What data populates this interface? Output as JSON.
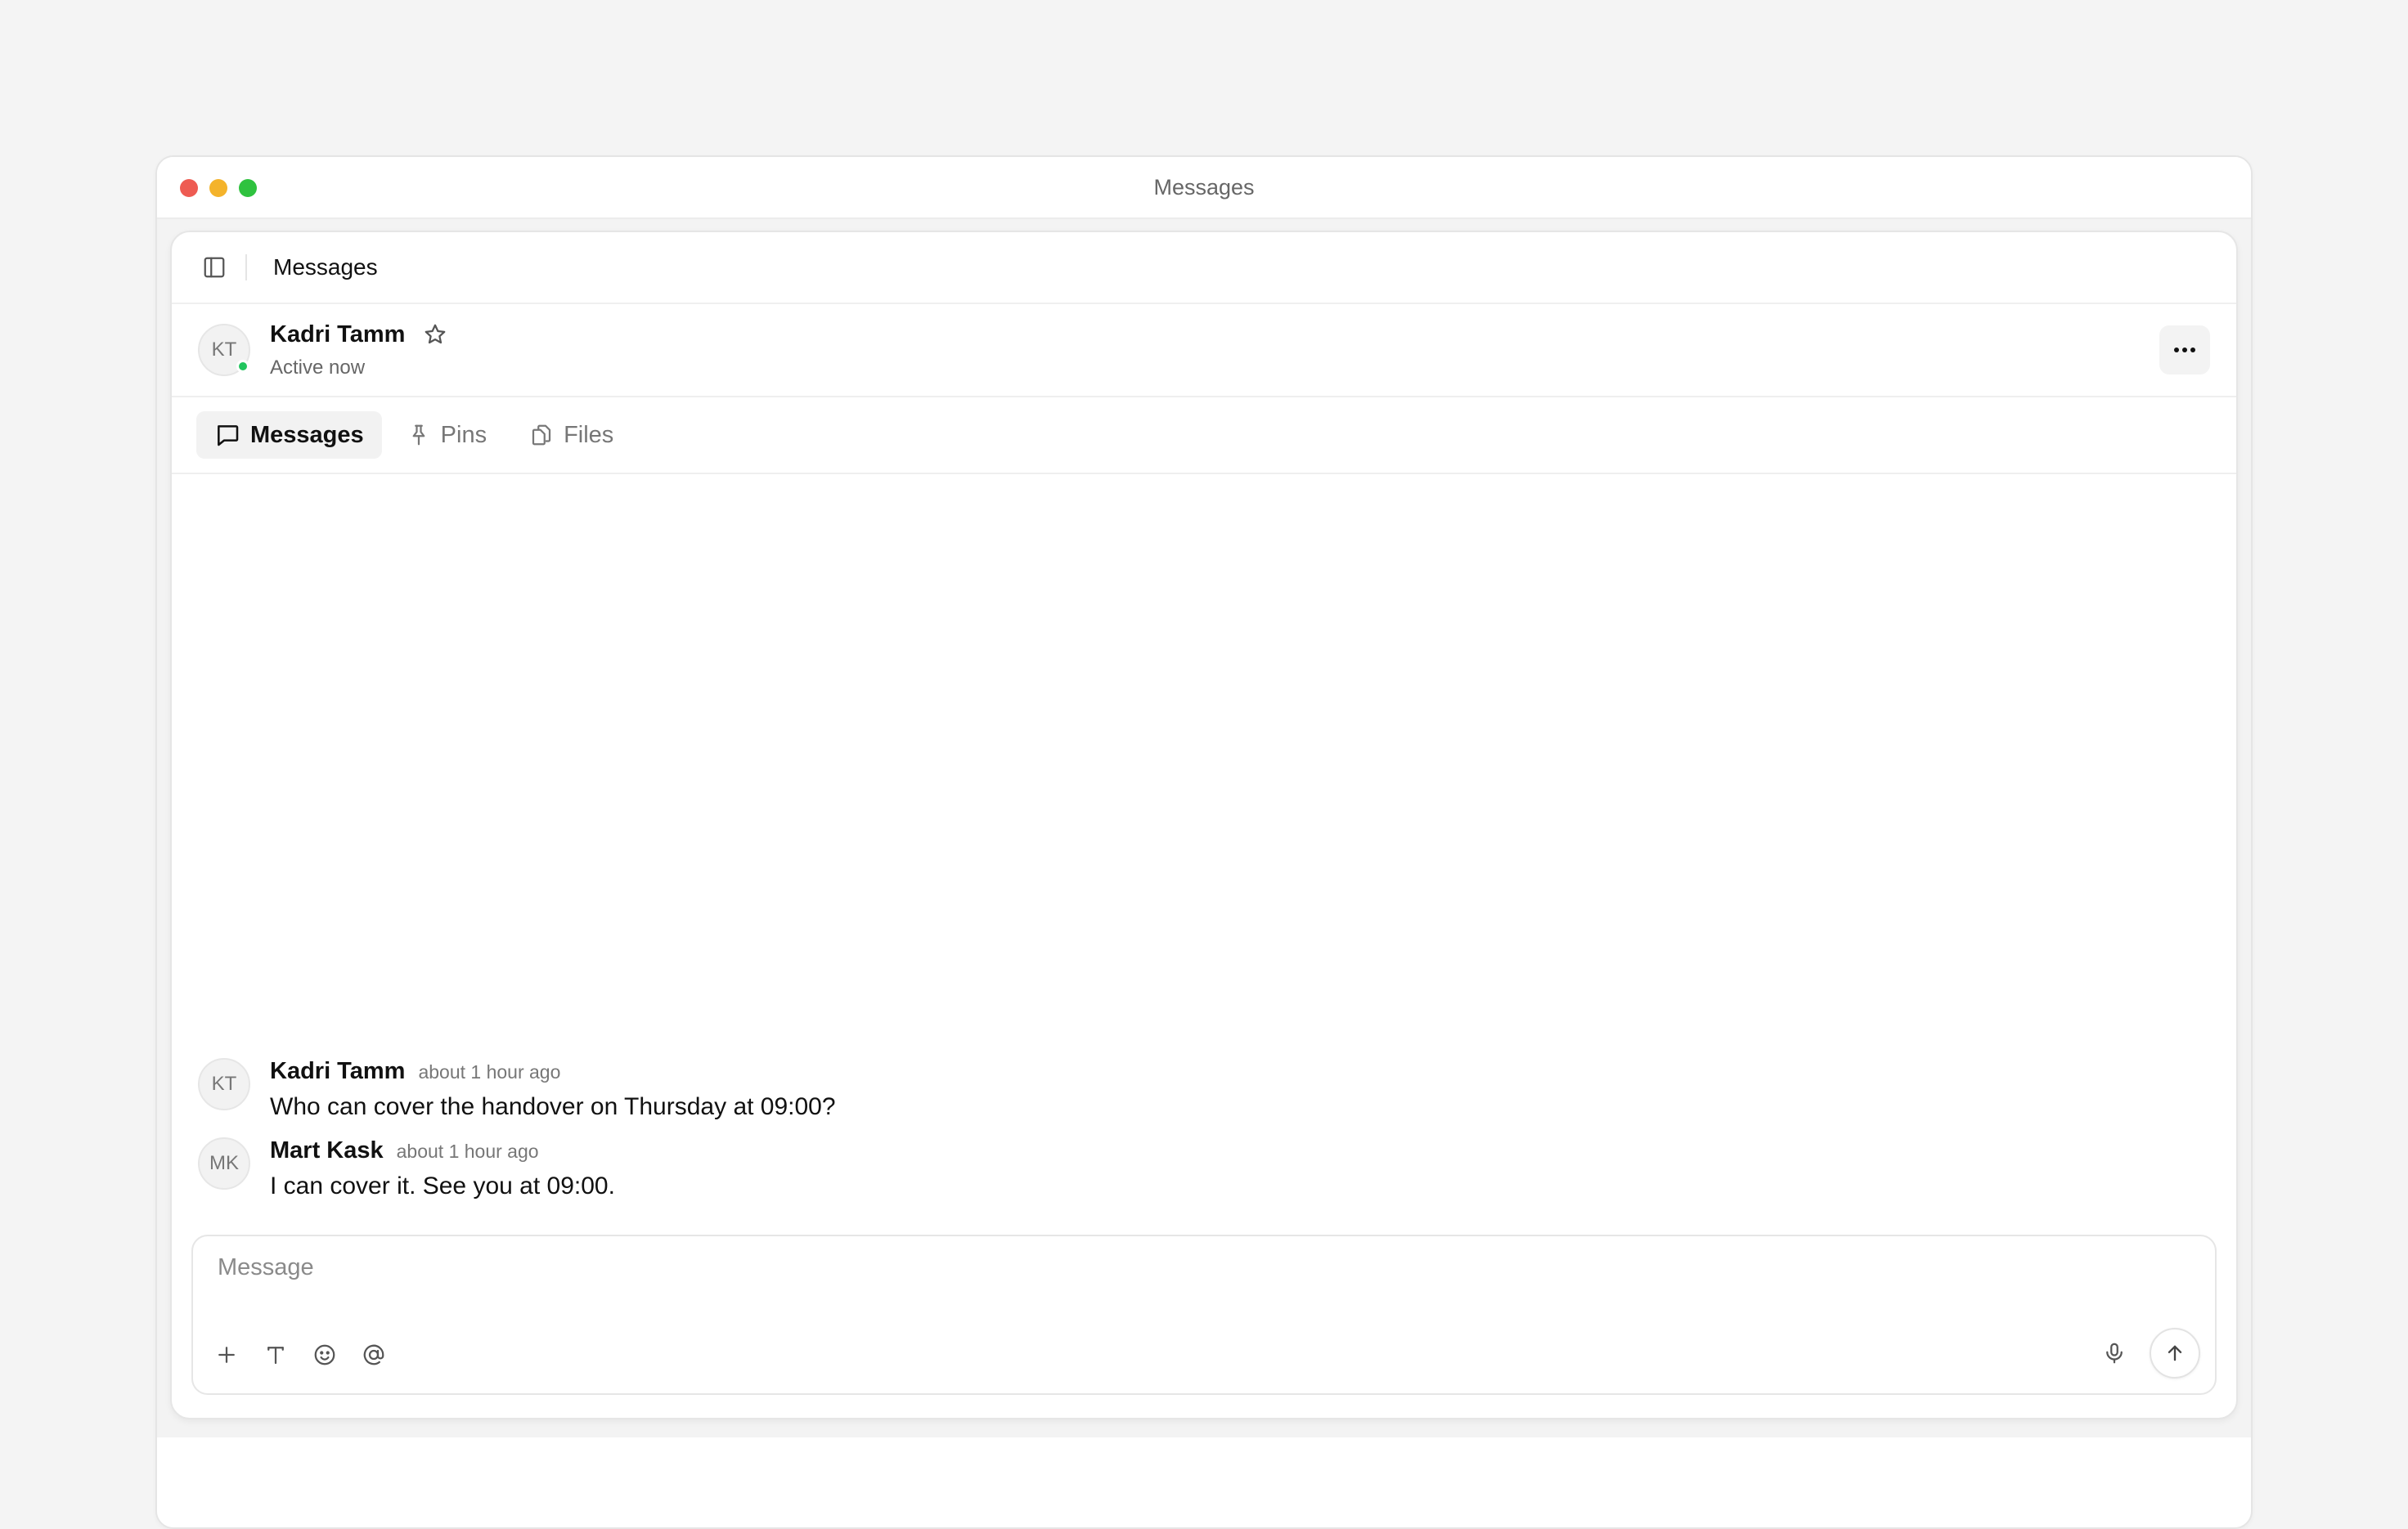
{
  "window": {
    "title": "Messages"
  },
  "topbar": {
    "title": "Messages"
  },
  "contact": {
    "initials": "KT",
    "name": "Kadri Tamm",
    "status": "Active now",
    "presence_color": "#22c55e"
  },
  "tabs": [
    {
      "label": "Messages",
      "icon": "message-square-icon",
      "active": true
    },
    {
      "label": "Pins",
      "icon": "pin-icon",
      "active": false
    },
    {
      "label": "Files",
      "icon": "files-icon",
      "active": false
    }
  ],
  "messages": [
    {
      "initials": "KT",
      "author": "Kadri Tamm",
      "time": "about 1 hour ago",
      "text": "Who can cover the handover on Thursday at 09:00?"
    },
    {
      "initials": "MK",
      "author": "Mart Kask",
      "time": "about 1 hour ago",
      "text": "I can cover it. See you at 09:00."
    }
  ],
  "composer": {
    "placeholder": "Message",
    "value": "",
    "tools": [
      "plus-icon",
      "text-format-icon",
      "emoji-icon",
      "mention-icon"
    ],
    "right_tools": [
      "microphone-icon",
      "send-arrow-icon"
    ]
  }
}
